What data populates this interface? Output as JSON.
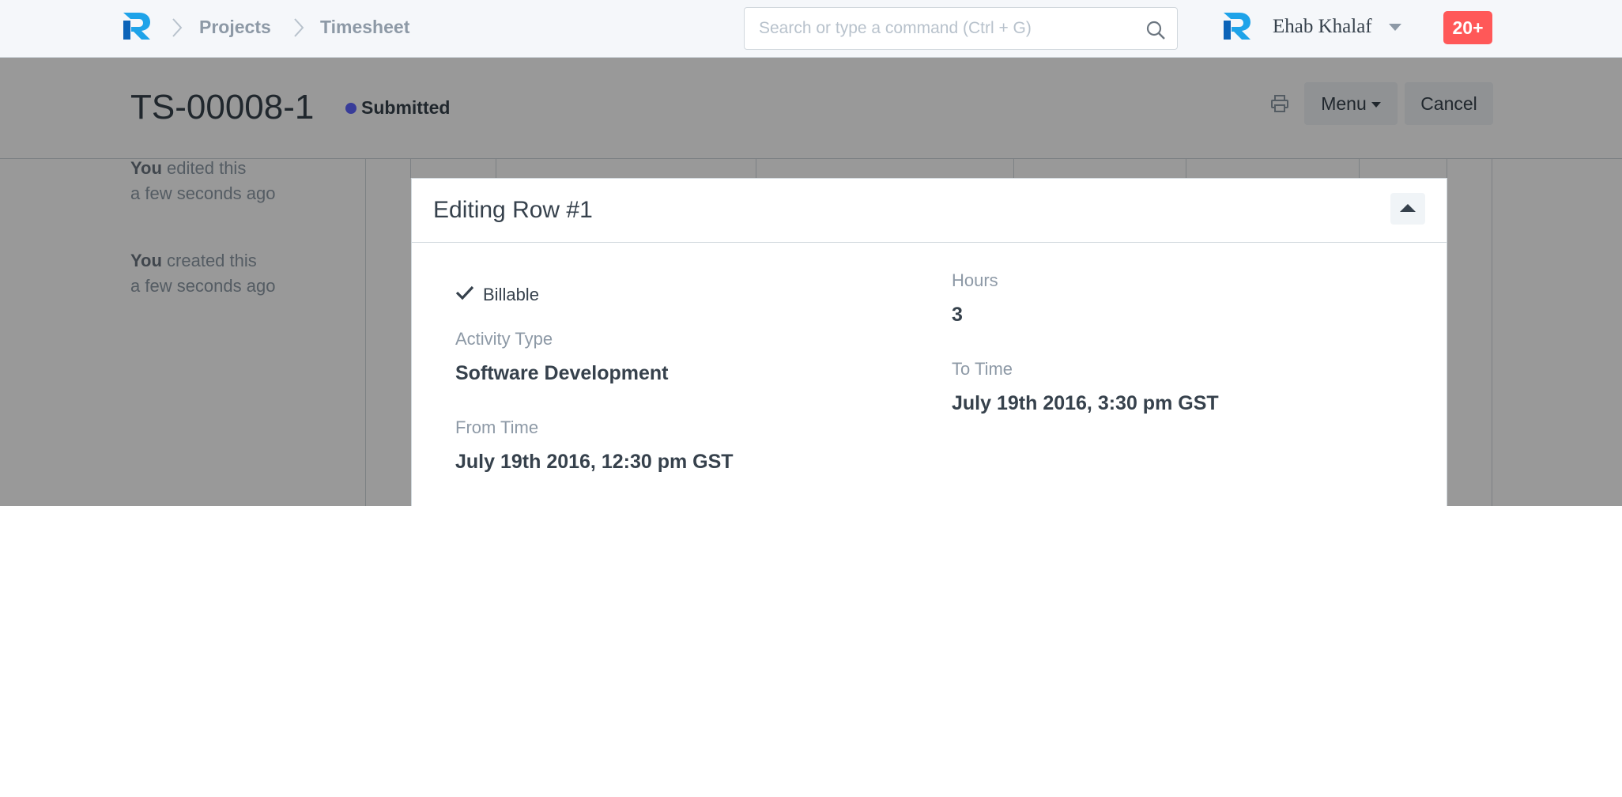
{
  "navbar": {
    "breadcrumbs": [
      "Projects",
      "Timesheet"
    ],
    "search": {
      "placeholder": "Search or type a command (Ctrl + G)",
      "value": ""
    },
    "user_name": "Ehab Khalaf",
    "notification_count": "20+",
    "icons": {
      "logo": "app-logo-icon",
      "search": "search-icon",
      "user": "user-avatar-icon"
    }
  },
  "page_head": {
    "title": "TS-00008-1",
    "status": "Submitted",
    "status_color": "#5e64ff",
    "menu_label": "Menu",
    "cancel_label": "Cancel"
  },
  "timeline": [
    {
      "actor": "You",
      "action": " edited this",
      "time": "a few seconds ago"
    },
    {
      "actor": "You",
      "action": " created this",
      "time": "a few seconds ago"
    }
  ],
  "editor": {
    "title": "Editing Row #1",
    "billable_label": "Billable",
    "billable_checked": true,
    "fields": {
      "activity_type": {
        "label": "Activity Type",
        "value": "Software Development"
      },
      "from_time": {
        "label": "From Time",
        "value": "July 19th 2016, 12:30 pm GST"
      },
      "hours": {
        "label": "Hours",
        "value": "3"
      },
      "to_time": {
        "label": "To Time",
        "value": "July 19th 2016, 3:30 pm GST"
      }
    }
  },
  "colors": {
    "accent": "#5e64ff",
    "badge": "#ff5858",
    "text": "#36414c",
    "muted": "#8d99a6"
  }
}
